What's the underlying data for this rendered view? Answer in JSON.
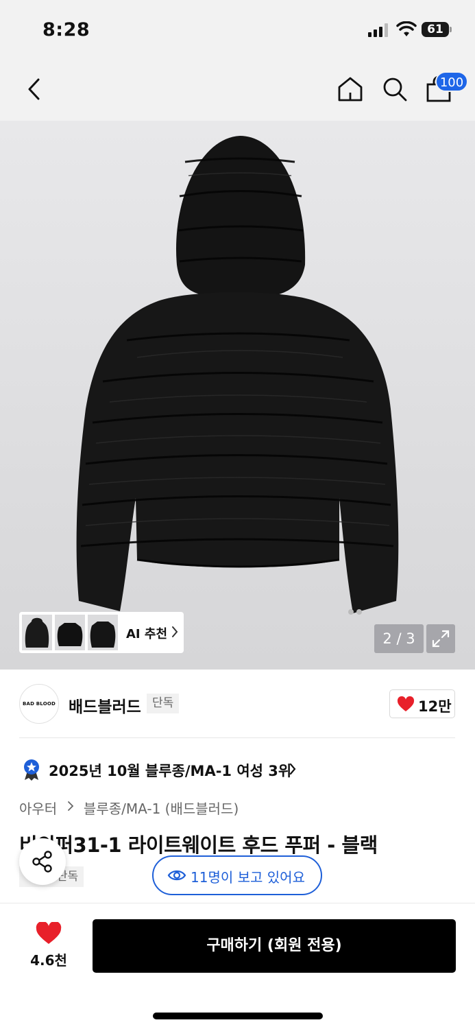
{
  "status_bar": {
    "time": "8:28",
    "battery": "61"
  },
  "header": {
    "cart_count": "100"
  },
  "gallery": {
    "ai_label": "AI 추천",
    "page_indicator": "2 / 3"
  },
  "brand": {
    "logo_text": "BAD BLOOD",
    "name": "배드블러드",
    "exclusive_tag": "단독",
    "like_count": "12만"
  },
  "ranking": {
    "text": "2025년 10월 블루종/MA-1 여성 3위"
  },
  "breadcrumb": {
    "items": [
      "아우터",
      "블루종/MA-1 (배드블러드)"
    ]
  },
  "product": {
    "title": "비의퍼31-1 라이트웨이트 후드 푸퍼 - 블랙",
    "tag": "무신사단독"
  },
  "viewers": {
    "text": "11명이 보고 있어요"
  },
  "bottom": {
    "like_count": "4.6천",
    "buy_label": "구매하기 (회원 전용)"
  },
  "colors": {
    "accent_blue": "#1e5fd8",
    "heart_red": "#e8202a",
    "buy_button": "#000000"
  }
}
